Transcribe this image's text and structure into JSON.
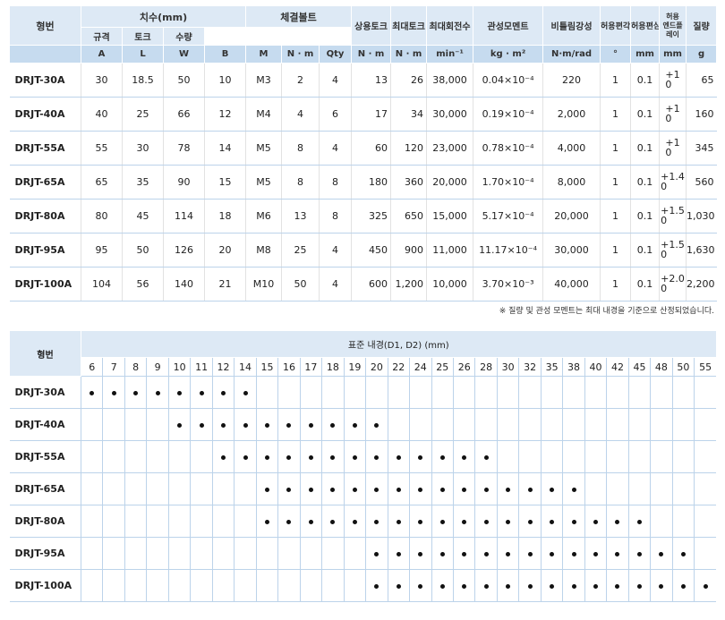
{
  "spec": {
    "header": {
      "model": "형번",
      "dims": "치수(mm)",
      "bolt": "체결볼트",
      "bolt_sub": [
        "규격",
        "토크",
        "수량"
      ],
      "rated_torque": "상용토크",
      "max_torque": "최대토크",
      "max_speed": "최대회전수",
      "inertia": "관성모멘트",
      "torsional": "비틀림강성",
      "angular": "허용편각",
      "eccentric": "허용편심",
      "endplay": "허용\n엔드플레이",
      "mass": "질량"
    },
    "units": [
      "A",
      "L",
      "W",
      "B",
      "M",
      "N · m",
      "Qty",
      "N · m",
      "N · m",
      "min⁻¹",
      "kg · m²",
      "N·m/rad",
      "°",
      "mm",
      "mm",
      "g"
    ],
    "rows": [
      {
        "model": "DRJT-30A",
        "A": "30",
        "L": "18.5",
        "W": "50",
        "B": "10",
        "M": "M3",
        "torque": "2",
        "qty": "4",
        "rated": "13",
        "max": "26",
        "speed": "38,000",
        "inertia": "0.04×10⁻⁴",
        "stiff": "220",
        "ang": "1",
        "ecc": "0.1",
        "end_top": "+1",
        "end_bot": "0",
        "mass": "65"
      },
      {
        "model": "DRJT-40A",
        "A": "40",
        "L": "25",
        "W": "66",
        "B": "12",
        "M": "M4",
        "torque": "4",
        "qty": "6",
        "rated": "17",
        "max": "34",
        "speed": "30,000",
        "inertia": "0.19×10⁻⁴",
        "stiff": "2,000",
        "ang": "1",
        "ecc": "0.1",
        "end_top": "+1",
        "end_bot": "0",
        "mass": "160"
      },
      {
        "model": "DRJT-55A",
        "A": "55",
        "L": "30",
        "W": "78",
        "B": "14",
        "M": "M5",
        "torque": "8",
        "qty": "4",
        "rated": "60",
        "max": "120",
        "speed": "23,000",
        "inertia": "0.78×10⁻⁴",
        "stiff": "4,000",
        "ang": "1",
        "ecc": "0.1",
        "end_top": "+1",
        "end_bot": "0",
        "mass": "345"
      },
      {
        "model": "DRJT-65A",
        "A": "65",
        "L": "35",
        "W": "90",
        "B": "15",
        "M": "M5",
        "torque": "8",
        "qty": "8",
        "rated": "180",
        "max": "360",
        "speed": "20,000",
        "inertia": "1.70×10⁻⁴",
        "stiff": "8,000",
        "ang": "1",
        "ecc": "0.1",
        "end_top": "+1.4",
        "end_bot": "0",
        "mass": "560"
      },
      {
        "model": "DRJT-80A",
        "A": "80",
        "L": "45",
        "W": "114",
        "B": "18",
        "M": "M6",
        "torque": "13",
        "qty": "8",
        "rated": "325",
        "max": "650",
        "speed": "15,000",
        "inertia": "5.17×10⁻⁴",
        "stiff": "20,000",
        "ang": "1",
        "ecc": "0.1",
        "end_top": "+1.5",
        "end_bot": "0",
        "mass": "1,030"
      },
      {
        "model": "DRJT-95A",
        "A": "95",
        "L": "50",
        "W": "126",
        "B": "20",
        "M": "M8",
        "torque": "25",
        "qty": "4",
        "rated": "450",
        "max": "900",
        "speed": "11,000",
        "inertia": "11.17×10⁻⁴",
        "stiff": "30,000",
        "ang": "1",
        "ecc": "0.1",
        "end_top": "+1.5",
        "end_bot": "0",
        "mass": "1,630"
      },
      {
        "model": "DRJT-100A",
        "A": "104",
        "L": "56",
        "W": "140",
        "B": "21",
        "M": "M10",
        "torque": "50",
        "qty": "4",
        "rated": "600",
        "max": "1,200",
        "speed": "10,000",
        "inertia": "3.70×10⁻³",
        "stiff": "40,000",
        "ang": "1",
        "ecc": "0.1",
        "end_top": "+2.0",
        "end_bot": "0",
        "mass": "2,200"
      }
    ],
    "note": "※ 질량 및 관성 모멘트는 최대 내경을 기준으로 산정되었습니다."
  },
  "bore": {
    "header": {
      "model": "형번",
      "title": "표준 내경(D1, D2) (mm)"
    },
    "sizes": [
      "6",
      "7",
      "8",
      "9",
      "10",
      "11",
      "12",
      "14",
      "15",
      "16",
      "17",
      "18",
      "19",
      "20",
      "22",
      "24",
      "25",
      "26",
      "28",
      "30",
      "32",
      "35",
      "38",
      "40",
      "42",
      "45",
      "48",
      "50",
      "55"
    ],
    "rows": [
      {
        "model": "DRJT-30A",
        "avail": [
          "6",
          "7",
          "8",
          "9",
          "10",
          "11",
          "12",
          "14"
        ]
      },
      {
        "model": "DRJT-40A",
        "avail": [
          "10",
          "11",
          "12",
          "14",
          "15",
          "16",
          "17",
          "18",
          "19",
          "20"
        ]
      },
      {
        "model": "DRJT-55A",
        "avail": [
          "12",
          "14",
          "15",
          "16",
          "17",
          "18",
          "19",
          "20",
          "22",
          "24",
          "25",
          "26",
          "28"
        ]
      },
      {
        "model": "DRJT-65A",
        "avail": [
          "15",
          "16",
          "17",
          "18",
          "19",
          "20",
          "22",
          "24",
          "25",
          "26",
          "28",
          "30",
          "32",
          "35",
          "38"
        ]
      },
      {
        "model": "DRJT-80A",
        "avail": [
          "15",
          "16",
          "17",
          "18",
          "19",
          "20",
          "22",
          "24",
          "25",
          "26",
          "28",
          "30",
          "32",
          "35",
          "38",
          "40",
          "42",
          "45"
        ]
      },
      {
        "model": "DRJT-95A",
        "avail": [
          "20",
          "22",
          "24",
          "25",
          "26",
          "28",
          "30",
          "32",
          "35",
          "38",
          "40",
          "42",
          "45",
          "48",
          "50"
        ]
      },
      {
        "model": "DRJT-100A",
        "avail": [
          "20",
          "22",
          "24",
          "25",
          "26",
          "28",
          "30",
          "32",
          "35",
          "38",
          "40",
          "42",
          "45",
          "48",
          "50",
          "55"
        ]
      }
    ]
  }
}
